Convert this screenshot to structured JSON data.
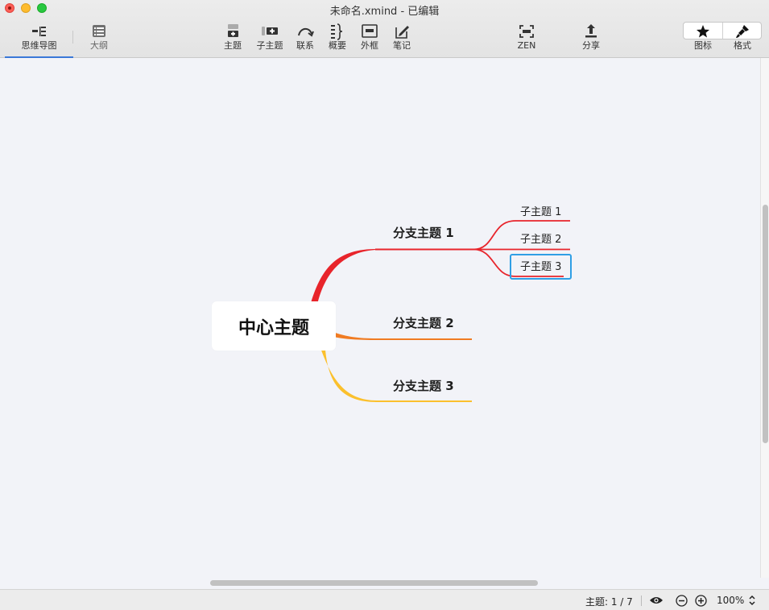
{
  "window": {
    "title": "未命名.xmind - 已编辑"
  },
  "toolbar": {
    "views": [
      {
        "label": "思维导图",
        "active": true
      },
      {
        "label": "大纲",
        "active": false
      }
    ],
    "insert": [
      {
        "label": "主题",
        "icon": "topic-icon"
      },
      {
        "label": "子主题",
        "icon": "subtopic-icon"
      },
      {
        "label": "联系",
        "icon": "relationship-icon"
      },
      {
        "label": "概要",
        "icon": "summary-icon"
      },
      {
        "label": "外框",
        "icon": "boundary-icon"
      },
      {
        "label": "笔记",
        "icon": "note-icon"
      }
    ],
    "zen_label": "ZEN",
    "share_label": "分享",
    "icons_label": "图标",
    "format_label": "格式"
  },
  "mindmap": {
    "central": "中心主题",
    "branches": [
      {
        "label": "分支主题 1",
        "color": "#e8242b",
        "subtopics": [
          "子主题 1",
          "子主题 2",
          "子主题 3"
        ]
      },
      {
        "label": "分支主题 2",
        "color": "#f07b22",
        "subtopics": []
      },
      {
        "label": "分支主题 3",
        "color": "#fbc02d",
        "subtopics": []
      }
    ],
    "selected": "子主题 3",
    "selection_color": "#2f9fe5"
  },
  "status": {
    "topic_count": "主题: 1 / 7",
    "zoom": "100%"
  }
}
